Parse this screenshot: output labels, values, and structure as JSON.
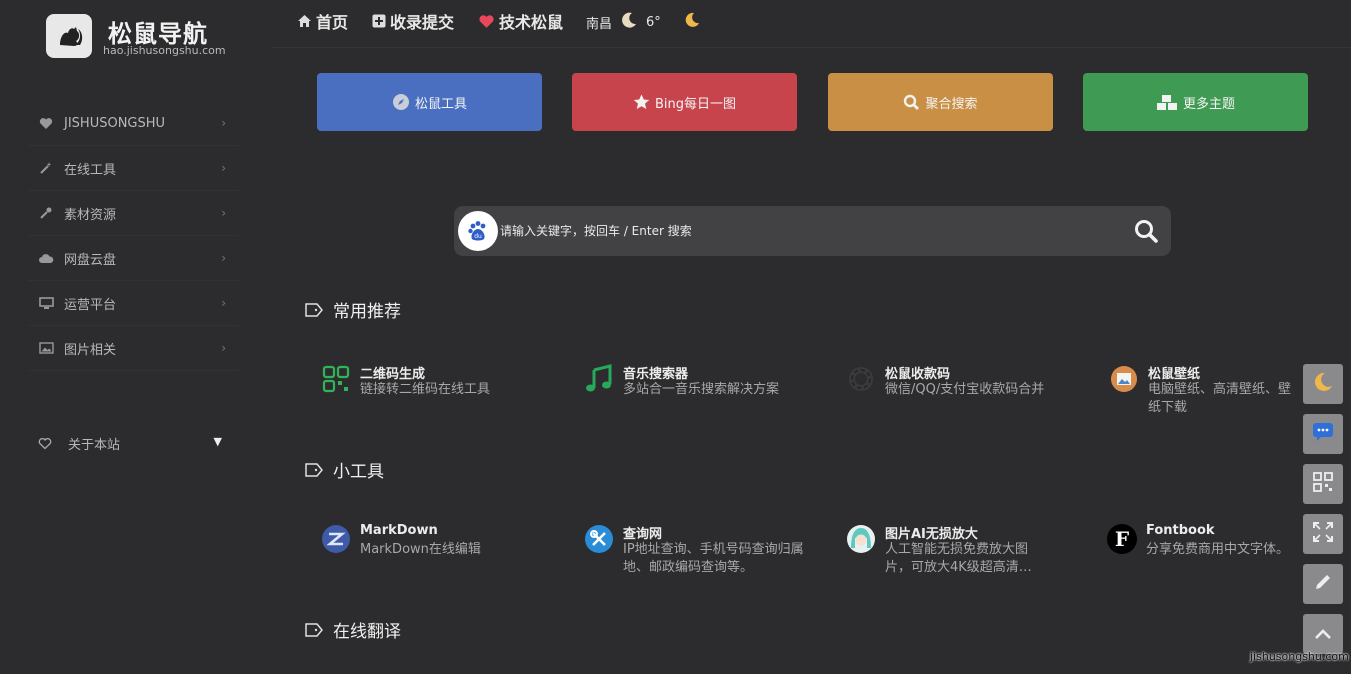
{
  "logo": {
    "title": "松鼠导航",
    "subtitle": "hao.jishusongshu.com"
  },
  "sidebar": {
    "items": [
      {
        "label": "JISHUSONGSHU",
        "icon": "heart-icon"
      },
      {
        "label": "在线工具",
        "icon": "magic-wand-icon"
      },
      {
        "label": "素材资源",
        "icon": "eyedropper-icon"
      },
      {
        "label": "网盘云盘",
        "icon": "cloud-icon"
      },
      {
        "label": "运营平台",
        "icon": "monitor-icon"
      },
      {
        "label": "图片相关",
        "icon": "image-icon"
      }
    ],
    "about": {
      "label": "关于本站",
      "icon": "heart-outline-icon"
    }
  },
  "topnav": {
    "home": "首页",
    "submit": "收录提交",
    "tech": "技术松鼠",
    "weather": {
      "city": "南昌",
      "temp": "6°"
    }
  },
  "quick_buttons": [
    {
      "label": "松鼠工具",
      "color": "#4a6fc1",
      "icon": "compass-icon"
    },
    {
      "label": "Bing每日一图",
      "color": "#c8444c",
      "icon": "star-icon"
    },
    {
      "label": "聚合搜索",
      "color": "#c98f45",
      "icon": "search-icon"
    },
    {
      "label": "更多主题",
      "color": "#3f9a53",
      "icon": "cubes-icon"
    }
  ],
  "search": {
    "placeholder": "请输入关键字，按回车 / Enter 搜索",
    "engine": "baidu-icon"
  },
  "sections": [
    {
      "title": "常用推荐"
    },
    {
      "title": "小工具"
    },
    {
      "title": "在线翻译"
    }
  ],
  "cards_recommend": [
    {
      "name": "二维码生成",
      "desc": "链接转二维码在线工具"
    },
    {
      "name": "音乐搜索器",
      "desc": "多站合一音乐搜索解决方案"
    },
    {
      "name": "松鼠收款码",
      "desc": "微信/QQ/支付宝收款码合并"
    },
    {
      "name": "松鼠壁纸",
      "desc": "电脑壁纸、高清壁纸、壁纸下载"
    }
  ],
  "cards_tools": [
    {
      "name": "MarkDown",
      "desc": "MarkDown在线编辑"
    },
    {
      "name": "查询网",
      "desc": "IP地址查询、手机号码查询归属地、邮政编码查询等。"
    },
    {
      "name": "图片AI无损放大",
      "desc": "人工智能无损免费放大图片，可放大4K级超高清…"
    },
    {
      "name": "Fontbook",
      "desc": "分享免费商用中文字体。"
    }
  ],
  "float_buttons": [
    "moon-icon",
    "chat-icon",
    "qrcode-icon",
    "fullscreen-icon",
    "pencil-icon",
    "arrow-up-icon"
  ],
  "watermark": "jishusongshu.com"
}
